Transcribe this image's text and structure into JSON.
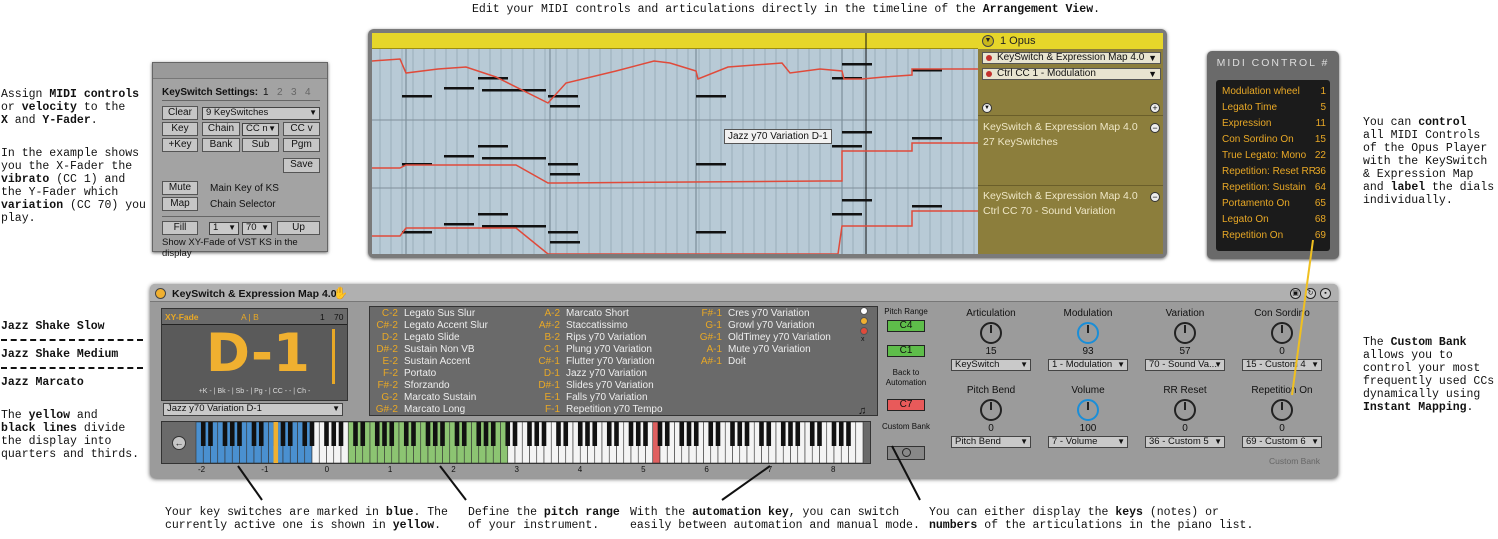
{
  "captions": {
    "top": [
      "Edit your MIDI controls and articulations directly in the timeline of the ",
      "Arrangement View",
      "."
    ],
    "left1": [
      "Assign ",
      "MIDI controls",
      "or ",
      "velocity",
      " to the",
      "X",
      " and ",
      "Y-Fader",
      "."
    ],
    "left2": [
      "In the example shows",
      "you the X-Fader the",
      "vibrato",
      " (CC 1) and",
      "the Y-Fader which",
      "variation",
      " (CC 70) you",
      "play."
    ],
    "shake_slow": "Jazz Shake Slow",
    "shake_medium": "Jazz Shake Medium",
    "marcato": "Jazz Marcato",
    "left3": [
      "The ",
      "yellow",
      " and",
      "black lines",
      " divide",
      "the display into",
      "quarters and thirds."
    ],
    "right1": [
      "You can ",
      "control",
      "all MIDI Controls",
      "of the Opus Player",
      "with the KeySwitch",
      "& Expression Map",
      "and ",
      "label",
      " the dials",
      "individually."
    ],
    "right2": [
      "The ",
      "Custom Bank",
      "allows you to",
      "control your most",
      "frequently used CCs",
      "dynamically using",
      "Instant Mapping",
      "."
    ],
    "bottom1": [
      "Your key switches are marked in ",
      "blue",
      ". The",
      "currently active one is shown in ",
      "yellow",
      "."
    ],
    "bottom2": [
      "Define the ",
      "pitch range",
      "of your instrument."
    ],
    "bottom3": [
      "With the ",
      "automation key",
      ", you can switch",
      "easily between automation and manual mode."
    ],
    "bottom4": [
      "You can either display the ",
      "keys",
      " (notes) or",
      "numbers",
      " of the articulations in the piano list."
    ]
  },
  "arrangement": {
    "track_title": "1 Opus",
    "device_select": "KeySwitch & Expression Map 4.0",
    "cc_select": "Ctrl CC  1 - Modulation",
    "lane2_name": "KeySwitch & Expression Map 4.0",
    "lane2_param": "27 KeySwitches",
    "lane3_name": "KeySwitch & Expression Map 4.0",
    "lane3_param": "Ctrl CC 70 - Sound Variation",
    "tooltip": "Jazz y70 Variation D-1",
    "colors": {
      "clip": "#e6d62a",
      "envelope": "#e04a3a",
      "timeline": "#b8cad6",
      "track": "#8c7e3c"
    }
  },
  "midi_control": {
    "title": "MIDI CONTROL #",
    "rows": [
      {
        "name": "Modulation wheel",
        "value": "1"
      },
      {
        "name": "Legato Time",
        "value": "5"
      },
      {
        "name": "Expression",
        "value": "11"
      },
      {
        "name": "Con Sordino On",
        "value": "15"
      },
      {
        "name": "True Legato: Mono",
        "value": "22"
      },
      {
        "name": "Repetition: Reset RR",
        "value": "36"
      },
      {
        "name": "Repetition: Sustain",
        "value": "64"
      },
      {
        "name": "Portamento On",
        "value": "65"
      },
      {
        "name": "Legato On",
        "value": "68"
      },
      {
        "name": "Repetition On",
        "value": "69"
      }
    ]
  },
  "ks_settings": {
    "title": "KeySwitch Settings:",
    "pages": [
      "1",
      "2",
      "3",
      "4"
    ],
    "clear": "Clear",
    "count": "9 KeySwitches",
    "key": "Key",
    "chain": "Chain",
    "ccn": "CC n",
    "ccv": "CC v",
    "pluskey": "+Key",
    "bank": "Bank",
    "sub": "Sub",
    "pgm": "Pgm",
    "save": "Save",
    "mute": "Mute",
    "mute_desc": "Main Key of KS",
    "map": "Map",
    "map_desc": "Chain Selector",
    "fill": "Fill",
    "fill_a": "1",
    "fill_b": "70",
    "up": "Up",
    "footer": "Show XY-Fade of VST KS in the display"
  },
  "device": {
    "title": "KeySwitch & Expression Map 4.0",
    "xy_label": "XY-Fade",
    "ab": "A | B",
    "val1": "1",
    "val2": "70",
    "big": "D-1",
    "display_footer": "+K - | Bk - | Sb - | Pg - | CC - - | Ch -",
    "current": "Jazz y70 Variation D-1",
    "col1": [
      [
        "C-2",
        "Legato Sus Slur"
      ],
      [
        "C#-2",
        "Legato Accent Slur"
      ],
      [
        "D-2",
        "Legato Slide"
      ],
      [
        "D#-2",
        "Sustain Non VB"
      ],
      [
        "E-2",
        "Sustain Accent"
      ],
      [
        "F-2",
        "Portato"
      ],
      [
        "F#-2",
        "Sforzando"
      ],
      [
        "G-2",
        "Marcato Sustain"
      ],
      [
        "G#-2",
        "Marcato Long"
      ]
    ],
    "col2": [
      [
        "A-2",
        "Marcato Short"
      ],
      [
        "A#-2",
        "Staccatissimo"
      ],
      [
        "B-2",
        "Rips y70 Variation"
      ],
      [
        "C-1",
        "Plung y70 Variation"
      ],
      [
        "C#-1",
        "Flutter y70 Variation"
      ],
      [
        "D-1",
        "Jazz y70 Variation"
      ],
      [
        "D#-1",
        "Slides y70 Variation"
      ],
      [
        "E-1",
        "Falls y70 Variation"
      ],
      [
        "F-1",
        "Repetition y70 Tempo"
      ]
    ],
    "col3": [
      [
        "F#-1",
        "Cres y70 Variation"
      ],
      [
        "G-1",
        "Growl y70 Variation"
      ],
      [
        "G#-1",
        "OldTimey y70 Variation"
      ],
      [
        "A-1",
        "Mute y70 Variation"
      ],
      [
        "A#-1",
        "Doit"
      ]
    ],
    "pitch_range": "Pitch Range",
    "pr_hi": "C4",
    "pr_lo": "C1",
    "back_to": "Back to Automation",
    "auto_key": "C7",
    "custom_bank_btn": "Custom Bank",
    "knobs": [
      {
        "label": "Articulation",
        "value": "15",
        "select": "KeySwitch"
      },
      {
        "label": "Modulation",
        "value": "93",
        "select": "1 - Modulation"
      },
      {
        "label": "Variation",
        "value": "57",
        "select": "70 - Sound Va..."
      },
      {
        "label": "Con Sordino",
        "value": "0",
        "select": "15 - Custom 4"
      },
      {
        "label": "Pitch Bend",
        "value": "0",
        "select": "Pitch Bend"
      },
      {
        "label": "Volume",
        "value": "100",
        "select": "7 - Volume"
      },
      {
        "label": "RR Reset",
        "value": "0",
        "select": "36 - Custom 5"
      },
      {
        "label": "Repetition On",
        "value": "0",
        "select": "69 - Custom 6"
      }
    ],
    "custom_bank": "Custom Bank",
    "octaves": [
      "-2",
      "-1",
      "0",
      "1",
      "2",
      "3",
      "4",
      "5",
      "6",
      "7",
      "8"
    ],
    "colors": {
      "keyswitch": "#4a90d0",
      "active": "#f0b030",
      "range": "#8cc472",
      "automation": "#e06060",
      "accent": "#e8a826"
    }
  }
}
